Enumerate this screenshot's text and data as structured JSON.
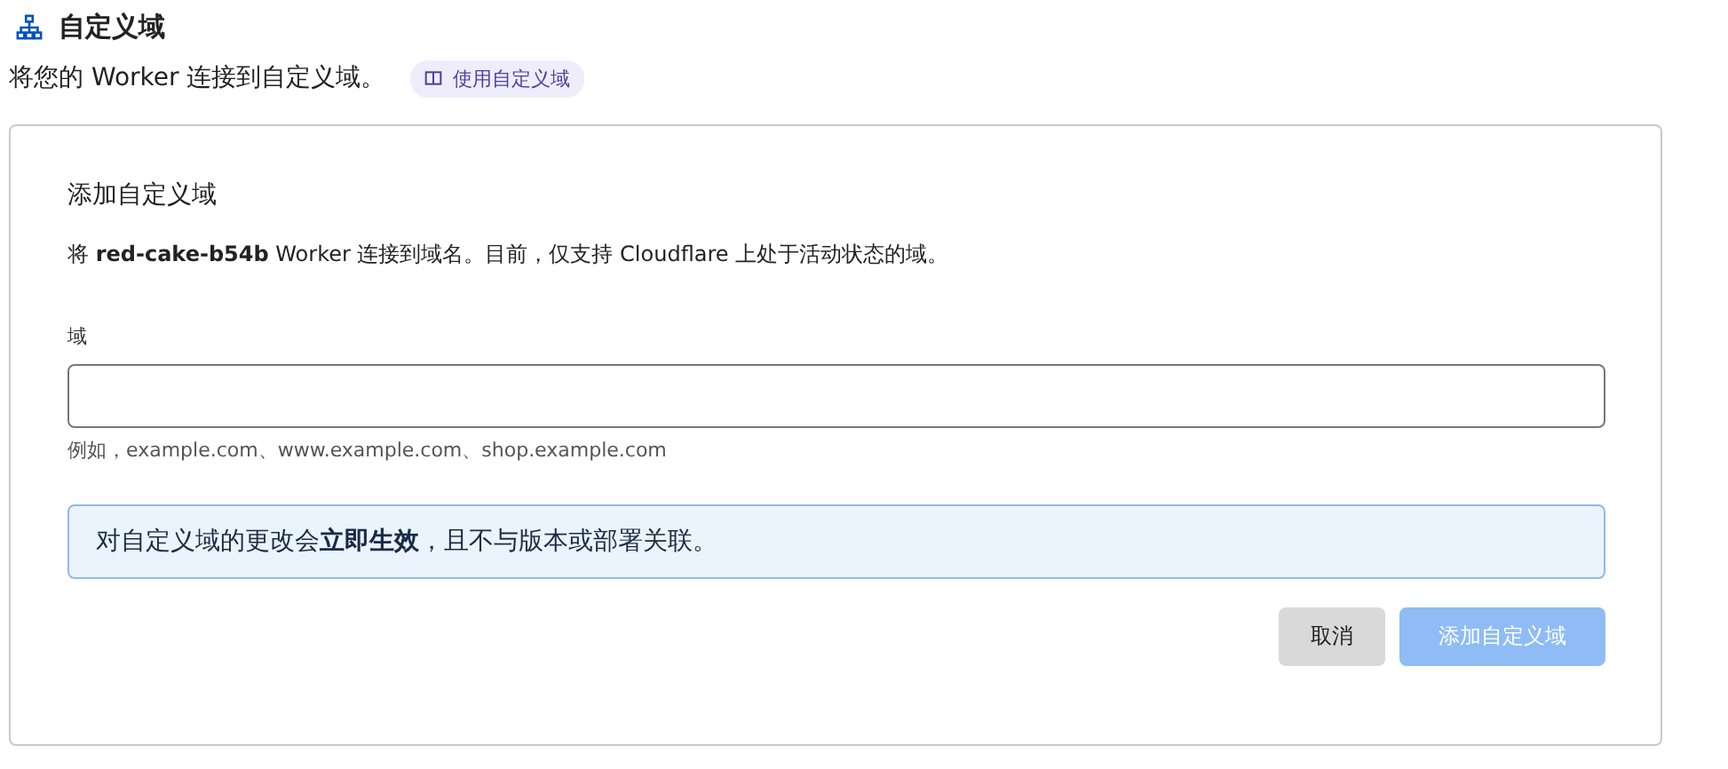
{
  "header": {
    "title": "自定义域",
    "description": "将您的 Worker 连接到自定义域。",
    "doc_link": "使用自定义域"
  },
  "card": {
    "title": "添加自定义域",
    "description": "将 **red-cake-b54b** Worker 连接到域名。目前，仅支持 Cloudflare 上处于活动状态的域。",
    "field": {
      "label": "域",
      "hint": "例如，example.com、www.example.com、shop.example.com"
    },
    "notice": "对自定义域的更改会**立即生效**，且不与版本或部署关联。",
    "buttons": [
      {
        "label": "取消",
        "kind": "secondary",
        "disabled": false
      },
      {
        "label": "添加自定义域",
        "kind": "primary",
        "disabled": true
      }
    ]
  }
}
